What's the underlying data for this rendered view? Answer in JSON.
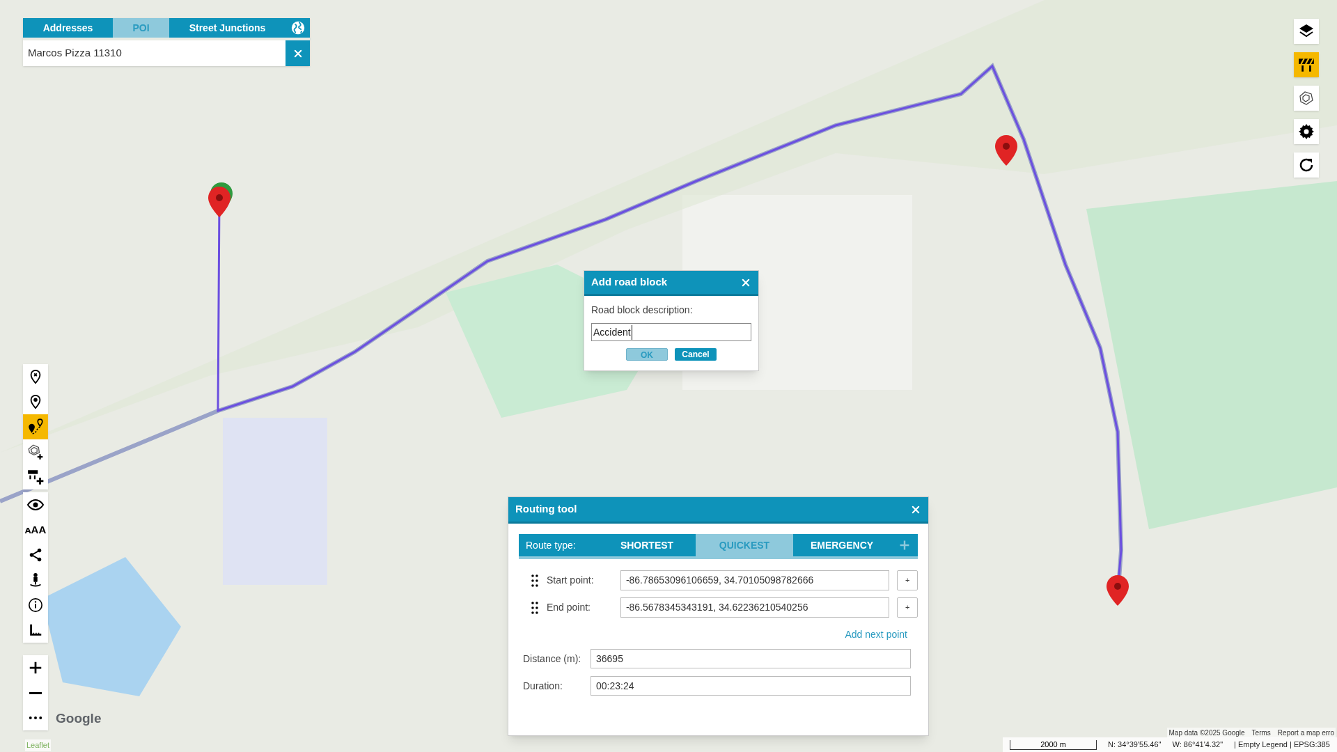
{
  "search": {
    "tabs": [
      {
        "label": "Addresses",
        "selected": false
      },
      {
        "label": "POI",
        "selected": true
      },
      {
        "label": "Street Junctions",
        "selected": false
      }
    ],
    "value": "Marcos Pizza 11310"
  },
  "left_toolbar": {
    "groups": [
      {
        "tools": [
          {
            "active": false
          },
          {
            "active": false
          },
          {
            "active": true
          },
          {
            "active": false
          },
          {
            "active": false
          }
        ]
      },
      {
        "tools": [
          {
            "active": false
          },
          {
            "active": false
          },
          {
            "active": false
          },
          {
            "active": false
          },
          {
            "active": false
          },
          {
            "active": false
          }
        ]
      },
      {
        "tools": [
          {
            "active": false
          },
          {
            "active": false
          },
          {
            "active": false
          }
        ]
      }
    ],
    "text_size_label": "ᴀAA"
  },
  "right_toolbar": {
    "tools": [
      {
        "active": false
      },
      {
        "active": true
      },
      {
        "active": false
      },
      {
        "active": false
      },
      {
        "active": false
      }
    ]
  },
  "road_block_dialog": {
    "title": "Add road block",
    "label": "Road block description:",
    "value": "Accident",
    "buttons": [
      {
        "label": "OK",
        "hovered": true
      },
      {
        "label": "Cancel",
        "hovered": false
      }
    ]
  },
  "routing_tool": {
    "title": "Routing tool",
    "route_type_label": "Route type:",
    "route_types": [
      {
        "label": "SHORTEST",
        "selected": false
      },
      {
        "label": "QUICKEST",
        "selected": true
      },
      {
        "label": "EMERGENCY",
        "selected": false
      }
    ],
    "points": [
      {
        "label": "Start point:",
        "value": "-86.78653096106659, 34.70105098782666",
        "button": "+"
      },
      {
        "label": "End point:",
        "value": "-86.5678345343191, 34.62236210540256",
        "button": "+"
      }
    ],
    "add_next_point": "Add next point",
    "distance_label": "Distance (m):",
    "distance": "36695",
    "duration_label": "Duration:",
    "duration": "00:23:24"
  },
  "map": {
    "google_logo": "Google",
    "leaflet": "Leaflet",
    "attribution": [
      "Map data ©2025 Google",
      "Terms",
      "Report a map erro"
    ]
  },
  "status_bar": {
    "scale": "2000 m",
    "latitude": "N: 34°39'55.46\"",
    "longitude": "W: 86°41'4.32\"",
    "legend": "| Empty Legend | EPSG:385"
  }
}
